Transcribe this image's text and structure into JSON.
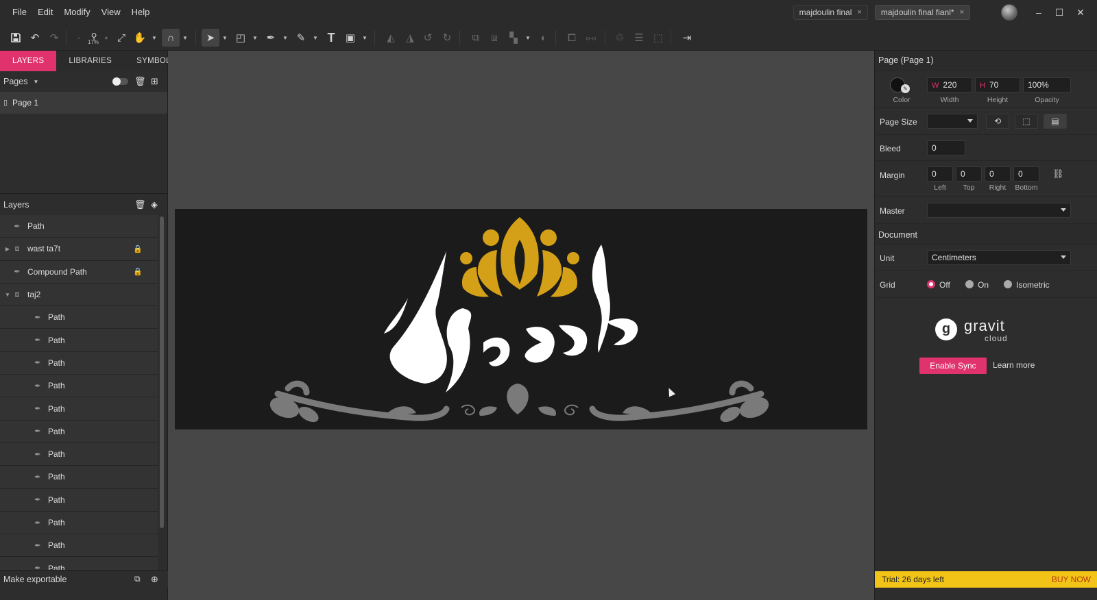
{
  "menu": [
    "File",
    "Edit",
    "Modify",
    "View",
    "Help"
  ],
  "doc_tabs": [
    {
      "label": "majdoulin final",
      "close": "×",
      "active": false
    },
    {
      "label": "majdoulin final fianl*",
      "close": "×",
      "active": true
    }
  ],
  "window_controls": {
    "minimize": "–",
    "maximize": "☐",
    "close": "✕"
  },
  "toolbar": {
    "zoom_minus": "-",
    "zoom_plus": "+",
    "zoom_level": "17%"
  },
  "left_tabs": [
    "LAYERS",
    "LIBRARIES",
    "SYMBOLS"
  ],
  "pages": {
    "header": "Pages",
    "items": [
      "Page 1"
    ]
  },
  "layers": {
    "header": "Layers",
    "items": [
      {
        "label": "Path",
        "type": "path",
        "indent": 0,
        "locked": false,
        "expander": ""
      },
      {
        "label": "wast ta7t",
        "type": "group",
        "indent": 0,
        "locked": true,
        "expander": "▶"
      },
      {
        "label": "Compound Path",
        "type": "path",
        "indent": 0,
        "locked": true,
        "expander": ""
      },
      {
        "label": "taj2",
        "type": "group",
        "indent": 0,
        "locked": false,
        "expander": "▼"
      },
      {
        "label": "Path",
        "type": "path",
        "indent": 1,
        "locked": false,
        "expander": ""
      },
      {
        "label": "Path",
        "type": "path",
        "indent": 1,
        "locked": false,
        "expander": ""
      },
      {
        "label": "Path",
        "type": "path",
        "indent": 1,
        "locked": false,
        "expander": ""
      },
      {
        "label": "Path",
        "type": "path",
        "indent": 1,
        "locked": false,
        "expander": ""
      },
      {
        "label": "Path",
        "type": "path",
        "indent": 1,
        "locked": false,
        "expander": ""
      },
      {
        "label": "Path",
        "type": "path",
        "indent": 1,
        "locked": false,
        "expander": ""
      },
      {
        "label": "Path",
        "type": "path",
        "indent": 1,
        "locked": false,
        "expander": ""
      },
      {
        "label": "Path",
        "type": "path",
        "indent": 1,
        "locked": false,
        "expander": ""
      },
      {
        "label": "Path",
        "type": "path",
        "indent": 1,
        "locked": false,
        "expander": ""
      },
      {
        "label": "Path",
        "type": "path",
        "indent": 1,
        "locked": false,
        "expander": ""
      },
      {
        "label": "Path",
        "type": "path",
        "indent": 1,
        "locked": false,
        "expander": ""
      },
      {
        "label": "Path",
        "type": "path",
        "indent": 1,
        "locked": false,
        "expander": ""
      }
    ]
  },
  "export": {
    "label": "Make exportable"
  },
  "inspector": {
    "title": "Page (Page 1)",
    "color_label": "Color",
    "width": {
      "prefix": "W",
      "value": "220",
      "label": "Width"
    },
    "height": {
      "prefix": "H",
      "value": "70",
      "label": "Height"
    },
    "opacity": {
      "value": "100%",
      "label": "Opacity"
    },
    "page_size_label": "Page Size",
    "page_size_value": "",
    "bleed_label": "Bleed",
    "bleed_value": "0",
    "margin_label": "Margin",
    "margins": [
      {
        "value": "0",
        "label": "Left"
      },
      {
        "value": "0",
        "label": "Top"
      },
      {
        "value": "0",
        "label": "Right"
      },
      {
        "value": "0",
        "label": "Bottom"
      }
    ],
    "master_label": "Master",
    "master_value": "",
    "document_label": "Document",
    "unit_label": "Unit",
    "unit_value": "Centimeters",
    "grid_label": "Grid",
    "grid_options": [
      "Off",
      "On",
      "Isometric"
    ],
    "grid_selected": "Off"
  },
  "cloud": {
    "brand": "gravit",
    "brand_sub": "cloud",
    "sync_button": "Enable Sync",
    "learn_more": "Learn more"
  },
  "trial": {
    "text": "Trial: 26 days left",
    "buy": "BUY NOW"
  },
  "colors": {
    "accent": "#e0336e",
    "crown": "#d4a017",
    "ornament": "#7a7a7a",
    "artboard": "#1b1b1b",
    "trial_bar": "#f2c418"
  }
}
